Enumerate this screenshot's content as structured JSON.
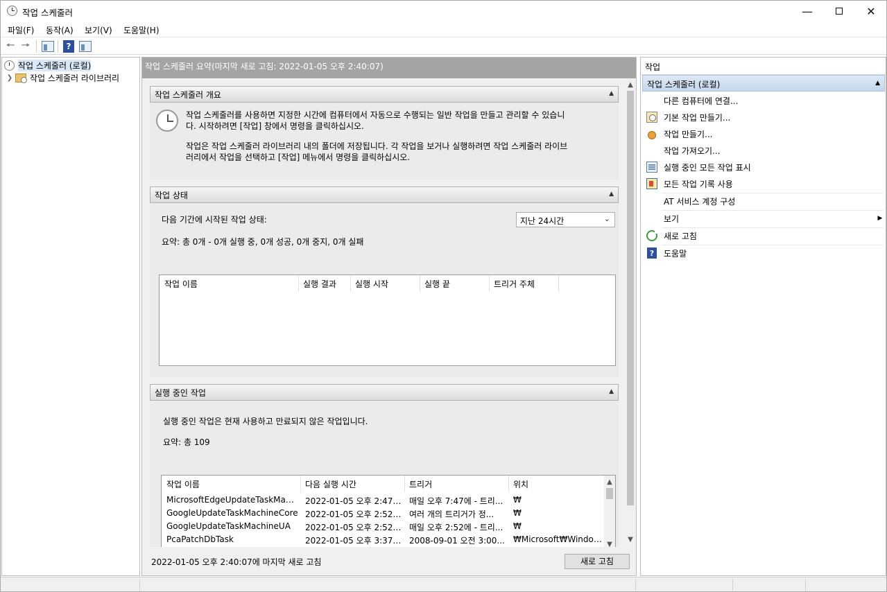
{
  "window": {
    "title": "작업 스케줄러"
  },
  "menu": {
    "file": "파일(F)",
    "action": "동작(A)",
    "view": "보기(V)",
    "help": "도움말(H)"
  },
  "tree": {
    "root": "작업 스케줄러 (로컬)",
    "library": "작업 스케줄러 라이브러리"
  },
  "main": {
    "header": "작업 스케줄러 요약(마지막 새로 고침: 2022-01-05 오후 2:40:07)",
    "overview": {
      "title": "작업 스케줄러 개요",
      "para1_line1": "작업 스케줄러를 사용하면 지정한 시간에 컴퓨터에서 자동으로 수행되는 일반 작업을 만들고 관리할 수 있습니",
      "para1_line2": "다. 시작하려면 [작업] 창에서 명령을 클릭하십시오.",
      "para2_line1": "작업은 작업 스케줄러 라이브러리 내의 폴더에 저장됩니다. 각 작업을 보거나 실행하려면 작업 스케줄러 라이브",
      "para2_line2": "러리에서 작업을 선택하고 [작업] 메뉴에서 명령을 클릭하십시오."
    },
    "status": {
      "title": "작업 상태",
      "period_label": "다음 기간에 시작된 작업 상태:",
      "period_value": "지난 24시간",
      "summary": "요약: 총 0개 - 0개 실행 중, 0개 성공, 0개 중지, 0개 실패",
      "columns": [
        "작업 이름",
        "실행 결과",
        "실행 시작",
        "실행 끝",
        "트리거 주체"
      ]
    },
    "active": {
      "title": "실행 중인 작업",
      "description": "실행 중인 작업은 현재 사용하고 만료되지 않은 작업입니다.",
      "summary": "요약: 총 109",
      "columns": [
        "작업 이름",
        "다음 실행 시간",
        "트리거",
        "위치"
      ],
      "rows": [
        [
          "MicrosoftEdgeUpdateTaskMachin...",
          "2022-01-05 오후 2:47:...",
          "매일 오후 7:47에 - 트리...",
          "₩"
        ],
        [
          "GoogleUpdateTaskMachineCore",
          "2022-01-05 오후 2:52:...",
          "여러 개의 트리거가 정...",
          "₩"
        ],
        [
          "GoogleUpdateTaskMachineUA",
          "2022-01-05 오후 2:52:...",
          "매일 오후 2:52에 - 트리...",
          "₩"
        ],
        [
          "PcaPatchDbTask",
          "2022-01-05 오후 3:37:...",
          "2008-09-01 오전 3:00...",
          "₩Microsoft₩Windows₩..."
        ]
      ]
    },
    "footer": {
      "last_refresh": "2022-01-05 오후 2:40:07에 마지막 새로 고침",
      "refresh_button": "새로 고침"
    }
  },
  "actions": {
    "header": "작업",
    "section": "작업 스케줄러 (로컬)",
    "items": [
      {
        "label": "다른 컴퓨터에 연결...",
        "icon": "none"
      },
      {
        "label": "기본 작업 만들기...",
        "icon": "basic-task-icon"
      },
      {
        "label": "작업 만들기...",
        "icon": "create-task-icon"
      },
      {
        "label": "작업 가져오기...",
        "icon": "none"
      },
      {
        "label": "실행 중인 모든 작업 표시",
        "icon": "running-tasks-icon"
      },
      {
        "label": "모든 작업 기록 사용",
        "icon": "history-icon"
      },
      {
        "label": "AT 서비스 계정 구성",
        "icon": "none"
      },
      {
        "label": "보기",
        "icon": "none"
      },
      {
        "label": "새로 고침",
        "icon": "refresh-icon"
      },
      {
        "label": "도움말",
        "icon": "help-icon"
      }
    ]
  }
}
